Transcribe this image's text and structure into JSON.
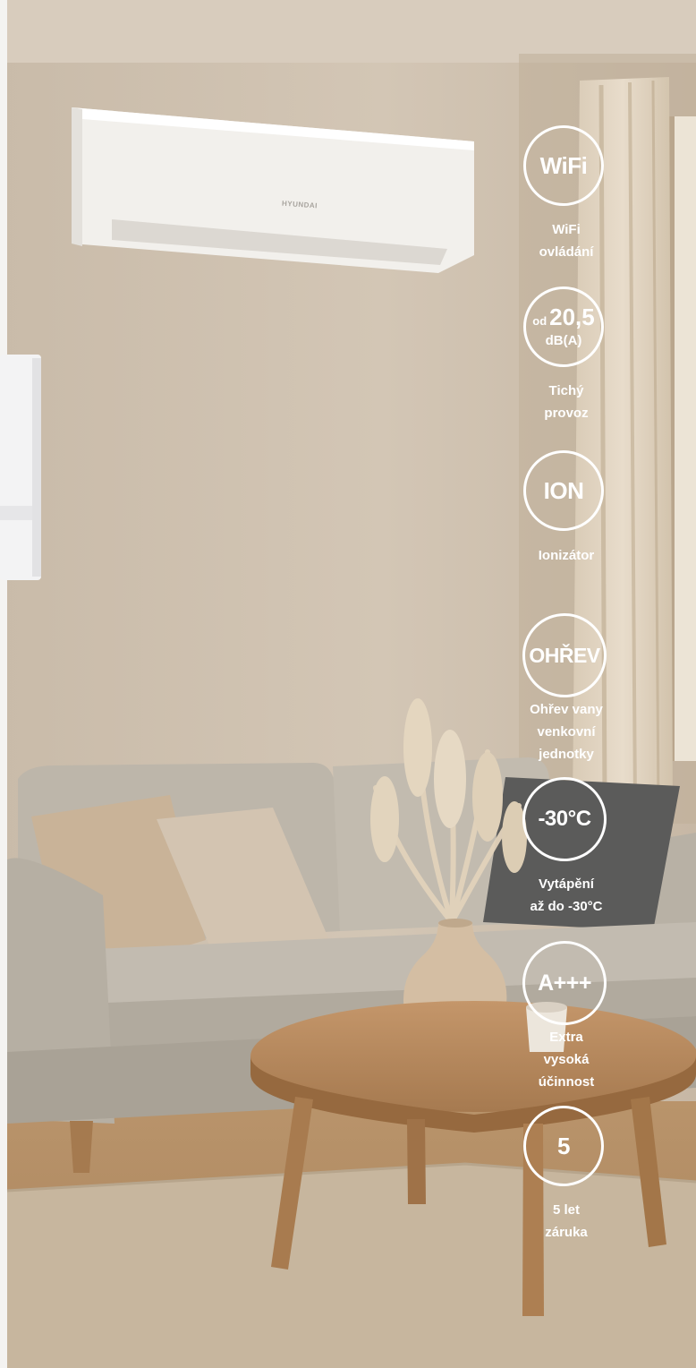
{
  "brand": {
    "unit_logo": "HYUNDAI"
  },
  "features": [
    {
      "symbol": "WiFi",
      "caption_lines": [
        "WiFi",
        "ovládání"
      ]
    },
    {
      "symbol_prefix": "od",
      "symbol": "20,5",
      "symbol_unit": "dB(A)",
      "caption_lines": [
        "Tichý",
        "provoz"
      ]
    },
    {
      "symbol": "ION",
      "caption_lines": [
        "Ionizátor"
      ]
    },
    {
      "symbol": "OHŘEV",
      "caption_lines": [
        "Ohřev vany",
        "venkovní",
        "jednotky"
      ]
    },
    {
      "symbol": "-30°C",
      "caption_lines": [
        "Vytápění",
        "až do -30°C"
      ]
    },
    {
      "symbol": "A+++",
      "caption_lines": [
        "Extra",
        "vysoká",
        "účinnost"
      ]
    },
    {
      "symbol": "5",
      "caption_lines": [
        "5 let",
        "záruka"
      ]
    }
  ],
  "colors": {
    "wall": "#cdbfae",
    "sofa": "#bdb6aa",
    "table": "#b8895a",
    "rug": "#c8b79f",
    "badge": "#ffffff"
  }
}
